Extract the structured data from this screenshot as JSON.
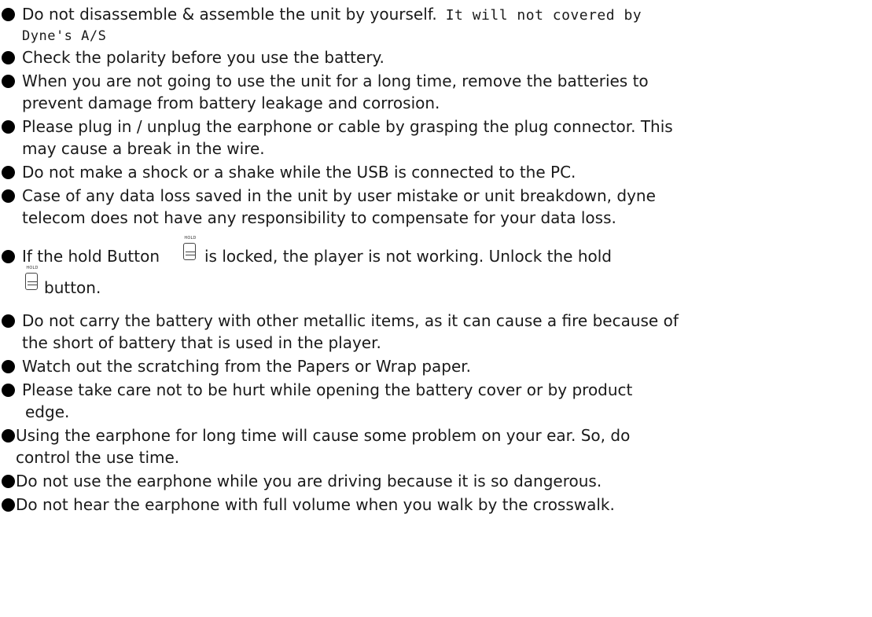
{
  "precautions": {
    "item1": {
      "line1_a": "Do not disassemble & assemble the unit by yourself.",
      "line1_b": "It will not covered by",
      "line2": "Dyne's A/S"
    },
    "item2": "Check the polarity before you use the battery.",
    "item3": {
      "line1": "When you are not going to use the unit for a long time, remove the batteries to",
      "line2": "prevent damage from battery leakage and corrosion."
    },
    "item4": {
      "line1": "Please plug in / unplug the earphone or cable by grasping the plug connector. This",
      "line2": "may cause a break in the wire."
    },
    "item5": "Do not make a shock or a shake while the USB is connected to the PC.",
    "item6": {
      "line1": "Case of any data loss saved in the unit by user mistake or unit breakdown, dyne",
      "line2": "telecom does not have any responsibility to compensate for your data loss."
    },
    "item7": {
      "text_a": "If the hold Button",
      "text_b": "is locked, the player is not working. Unlock the hold",
      "text_c": "button.",
      "icon_caption": "HOLD"
    },
    "item8": {
      "line1": "Do not carry the battery with other metallic items, as it can cause a fire because of",
      "line2": "the short of battery that is used in the player."
    },
    "item9": "Watch out the scratching from the Papers or Wrap paper.",
    "item10": {
      "line1": "Please take care not to be hurt while opening the battery cover or by product",
      "line2": "edge."
    },
    "item11": {
      "line1": "Using the earphone for long time will cause some problem on your ear. So, do",
      "line2": "control the use time."
    },
    "item12": "Do not use the earphone while you are driving because it is so dangerous.",
    "item13": "Do not hear the earphone with full volume when you walk by the crosswalk."
  }
}
